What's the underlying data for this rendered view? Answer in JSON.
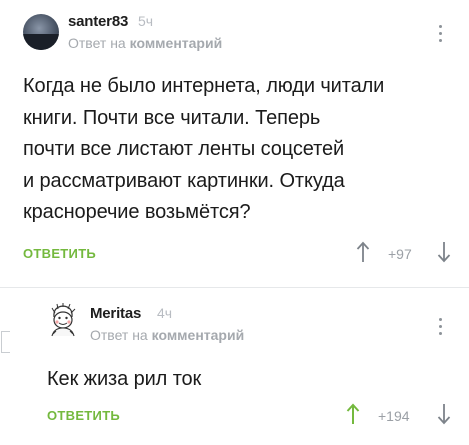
{
  "comments": [
    {
      "username": "santer83",
      "time": "5ч",
      "reply_prefix": "Ответ на",
      "reply_target": "комментарий",
      "lines": [
        "Когда не было интернета, люди читали",
        "книги. Почти все читали. Теперь",
        "почти все листают ленты соцсетей",
        "и рассматривают картинки. Откуда",
        "красноречие возьмётся?"
      ],
      "reply_label": "ОТВЕТИТЬ",
      "score": "+97",
      "upvoted": false
    },
    {
      "username": "Meritas",
      "time": "4ч",
      "reply_prefix": "Ответ на",
      "reply_target": "комментарий",
      "lines": [
        "Кек жиза рил ток"
      ],
      "reply_label": "ОТВЕТИТЬ",
      "score": "+194",
      "upvoted": true
    }
  ],
  "icons": {
    "menu": "kebab-menu-icon",
    "upvote": "arrow-up-icon",
    "downvote": "arrow-down-icon"
  },
  "colors": {
    "accent_green": "#74b93e",
    "muted_gray": "#a5a9ae",
    "divider": "#e6e8ea"
  }
}
